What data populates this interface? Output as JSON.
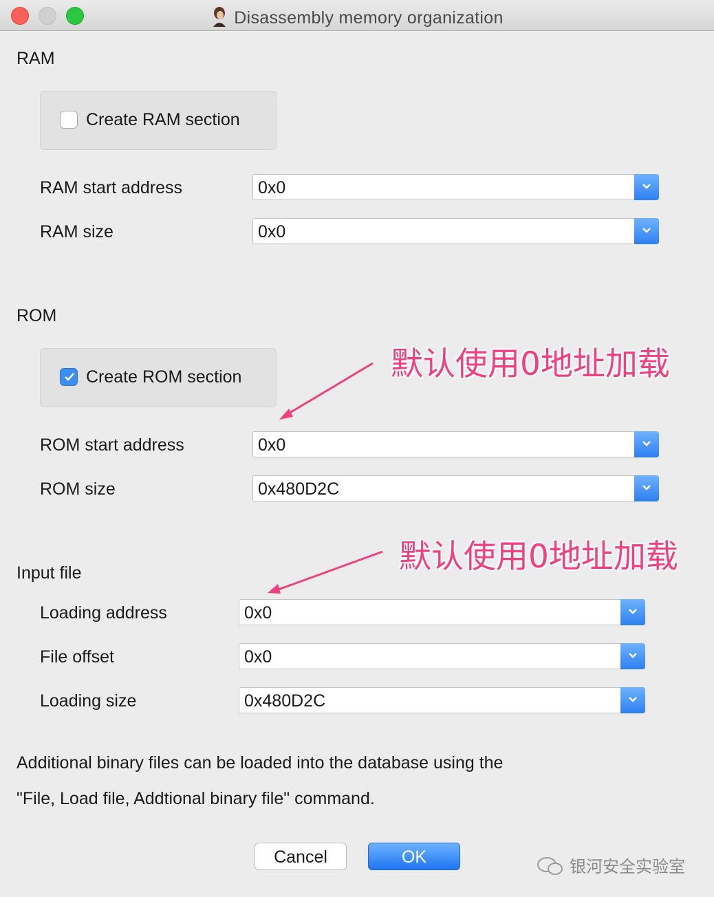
{
  "window": {
    "title": "Disassembly memory organization"
  },
  "ram": {
    "section_label": "RAM",
    "create_label": "Create RAM section",
    "create_checked": false,
    "start_label": "RAM start address",
    "start_value": "0x0",
    "size_label": "RAM size",
    "size_value": "0x0"
  },
  "rom": {
    "section_label": "ROM",
    "create_label": "Create ROM section",
    "create_checked": true,
    "start_label": "ROM start address",
    "start_value": "0x0",
    "size_label": "ROM size",
    "size_value": "0x480D2C"
  },
  "input": {
    "section_label": "Input file",
    "loading_address_label": "Loading address",
    "loading_address_value": "0x0",
    "file_offset_label": "File offset",
    "file_offset_value": "0x0",
    "loading_size_label": "Loading size",
    "loading_size_value": "0x480D2C"
  },
  "note": {
    "line1": "Additional binary files can be loaded into the database using the",
    "line2": "\"File, Load file, Addtional binary file\" command."
  },
  "buttons": {
    "cancel": "Cancel",
    "ok": "OK"
  },
  "annotations": {
    "rom": "默认使用0地址加载",
    "input": "默认使用0地址加载",
    "color": "#f0407f"
  },
  "watermark": "银河安全实验室",
  "colors": {
    "accent": "#3b8ff2",
    "annotation": "#f0407f"
  }
}
